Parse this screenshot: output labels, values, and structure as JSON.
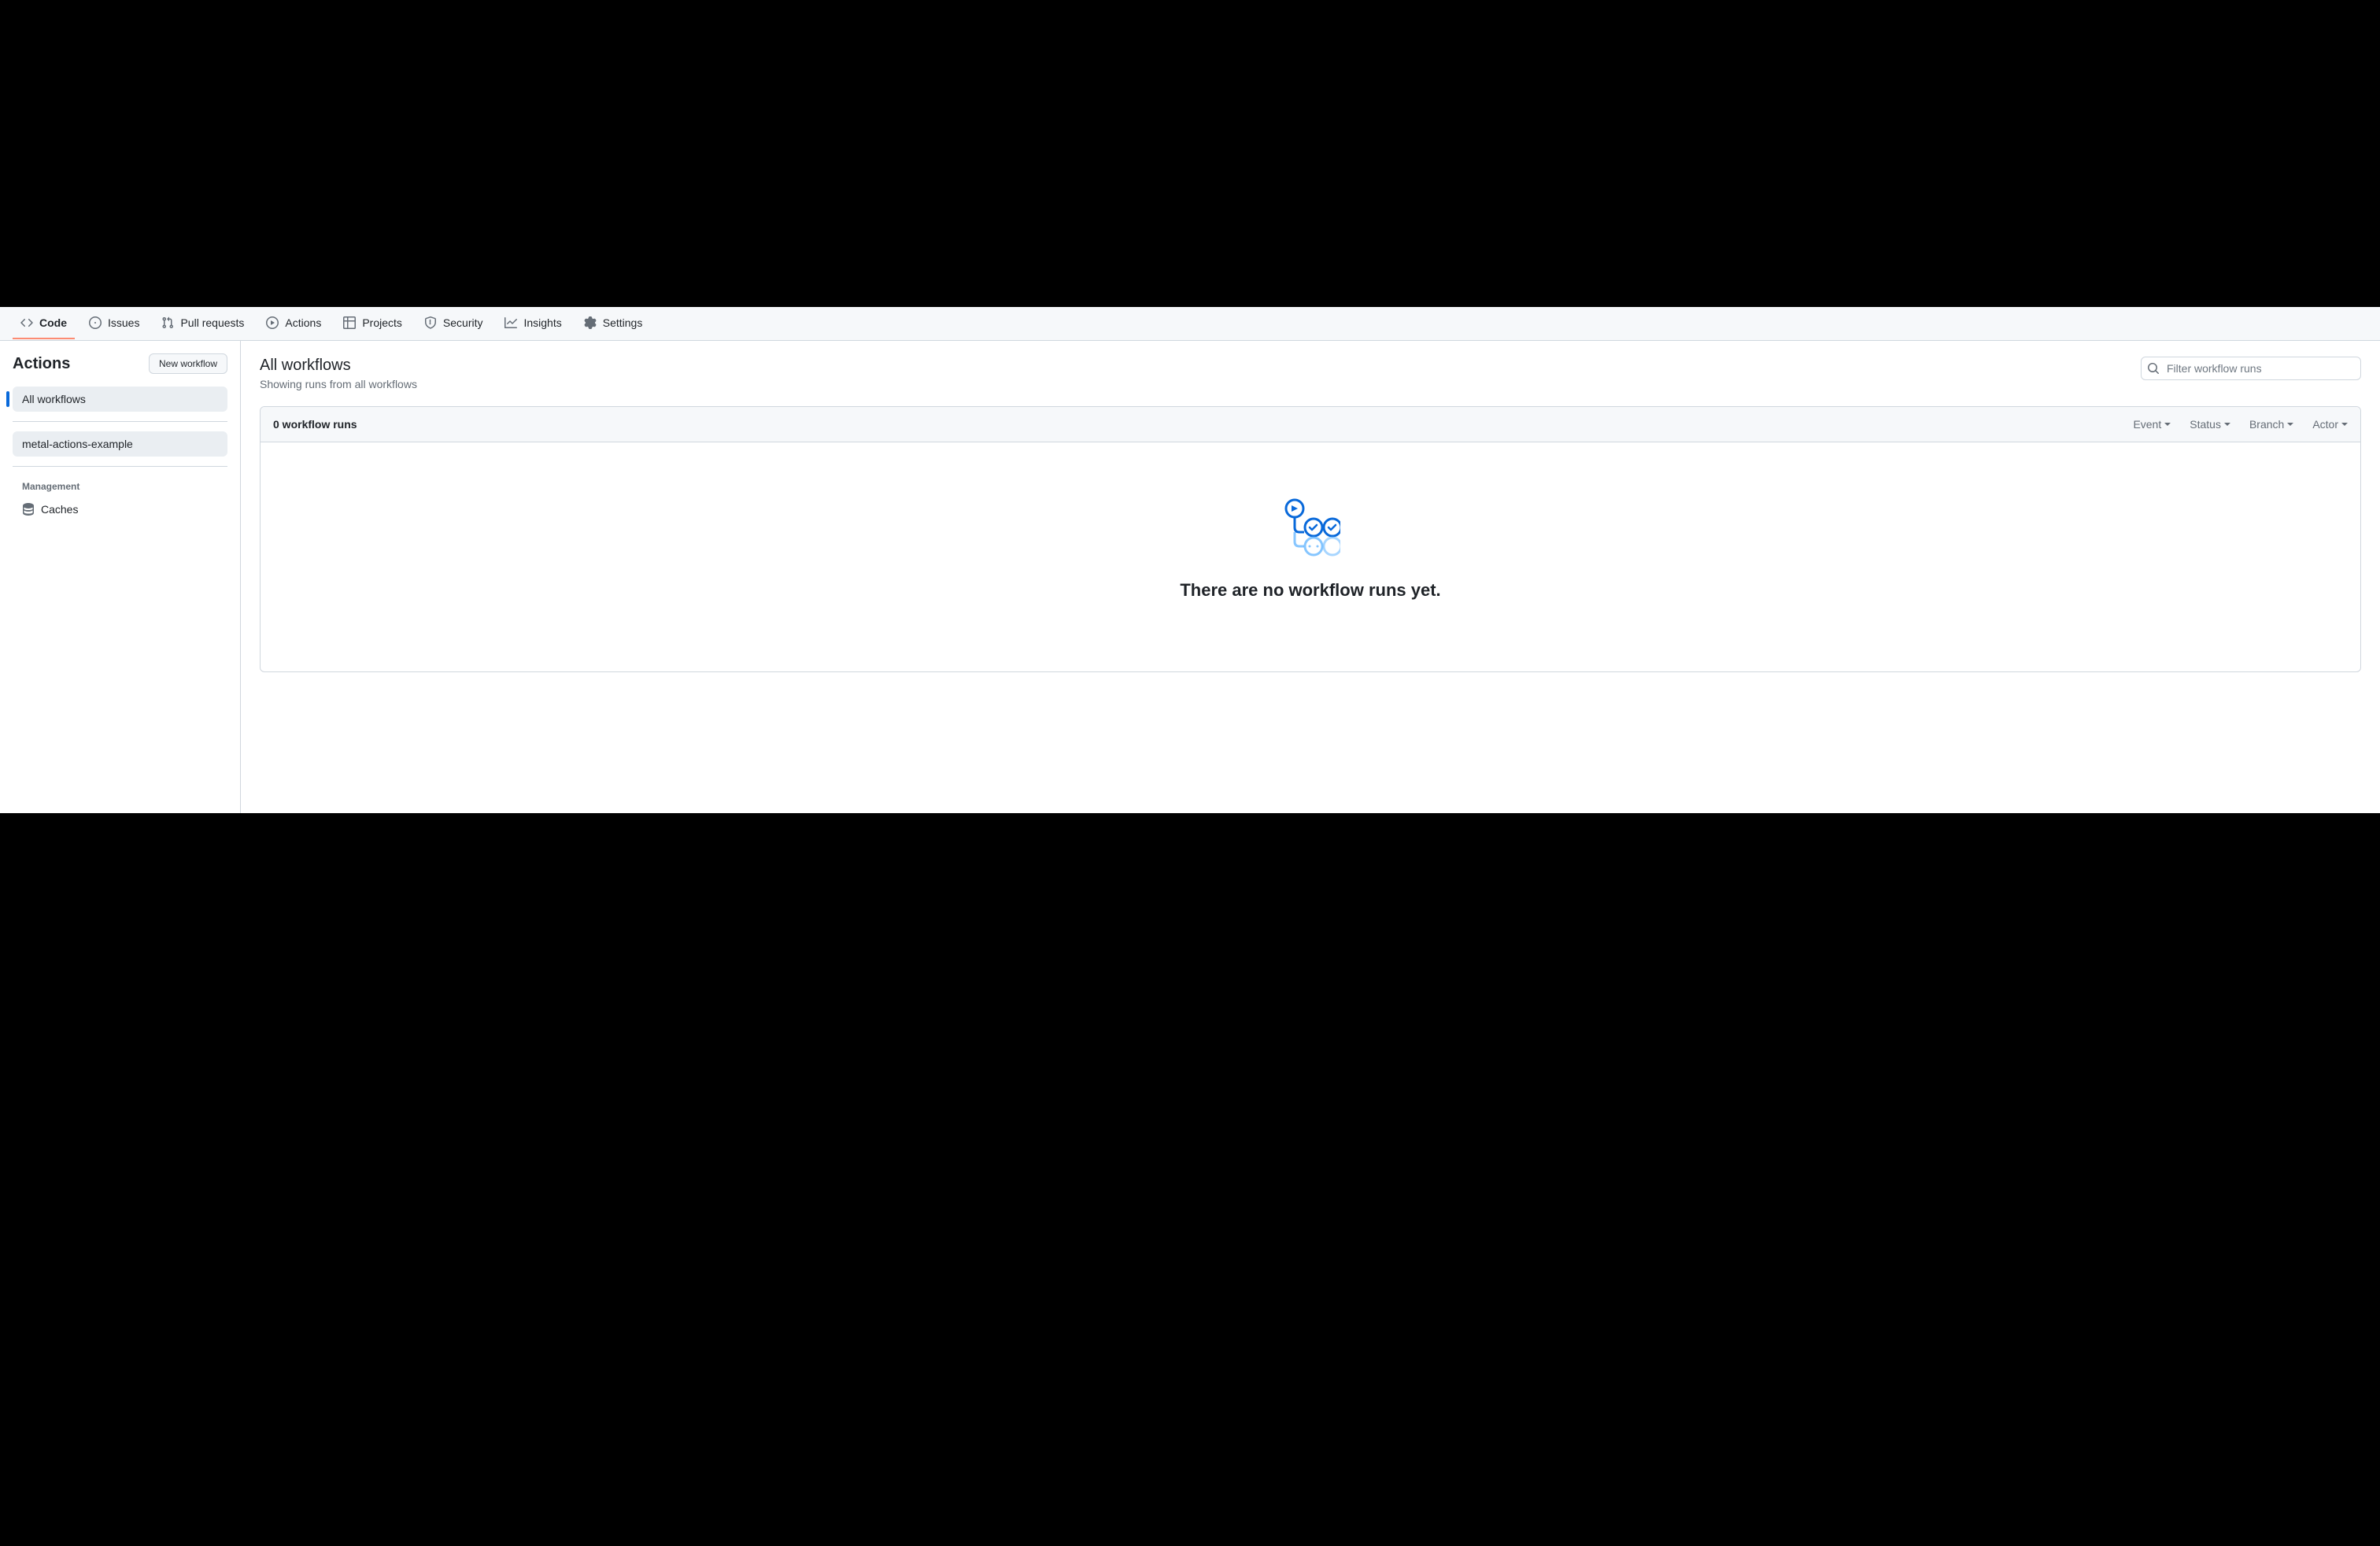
{
  "repoNav": {
    "tabs": [
      {
        "id": "code",
        "label": "Code",
        "selected": true
      },
      {
        "id": "issues",
        "label": "Issues",
        "selected": false
      },
      {
        "id": "pulls",
        "label": "Pull requests",
        "selected": false
      },
      {
        "id": "actions",
        "label": "Actions",
        "selected": false
      },
      {
        "id": "projects",
        "label": "Projects",
        "selected": false
      },
      {
        "id": "security",
        "label": "Security",
        "selected": false
      },
      {
        "id": "insights",
        "label": "Insights",
        "selected": false
      },
      {
        "id": "settings",
        "label": "Settings",
        "selected": false
      }
    ]
  },
  "sidebar": {
    "title": "Actions",
    "newWorkflowLabel": "New workflow",
    "items": [
      {
        "label": "All workflows",
        "active": true
      },
      {
        "label": "metal-actions-example",
        "active": false,
        "highlight": true
      }
    ],
    "managementLabel": "Management",
    "management": [
      {
        "label": "Caches",
        "icon": "database-icon"
      }
    ]
  },
  "main": {
    "title": "All workflows",
    "subtitle": "Showing runs from all workflows",
    "filterPlaceholder": "Filter workflow runs",
    "runsCount": "0 workflow runs",
    "filterDropdowns": [
      {
        "label": "Event"
      },
      {
        "label": "Status"
      },
      {
        "label": "Branch"
      },
      {
        "label": "Actor"
      }
    ],
    "emptyTitle": "There are no workflow runs yet."
  }
}
